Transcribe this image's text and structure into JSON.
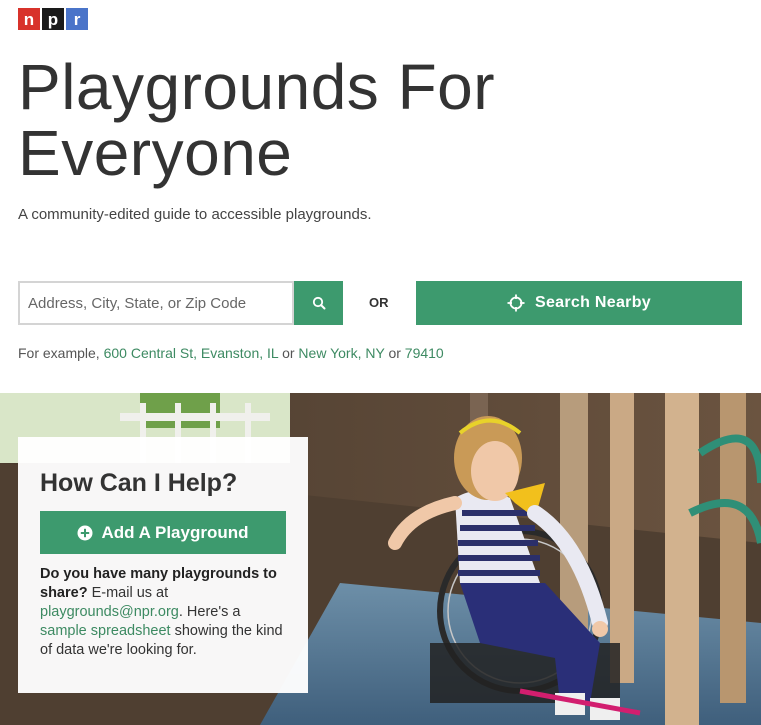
{
  "logo": {
    "letters": [
      "n",
      "p",
      "r"
    ]
  },
  "title": "Playgrounds For Everyone",
  "tagline": "A community-edited guide to accessible playgrounds.",
  "search": {
    "placeholder": "Address, City, State, or Zip Code",
    "button_icon": "search-icon",
    "or_label": "OR",
    "nearby_label": "Search Nearby",
    "nearby_icon": "crosshair-icon"
  },
  "examples": {
    "prefix": "For example,",
    "link1": "600 Central St, Evanston, IL",
    "sep1": "or",
    "link2": "New York, NY",
    "sep2": "or",
    "link3": "79410"
  },
  "help": {
    "title": "How Can I Help?",
    "add_label": "Add A Playground",
    "add_icon": "plus-circle-icon",
    "question": "Do you have many playgrounds to share?",
    "email_pre": "E-mail us at",
    "email": "playgrounds@npr.org",
    "mid": ". Here's a",
    "sheet_link": "sample spreadsheet",
    "tail": "showing the kind of data we're looking for."
  },
  "colors": {
    "accent": "#3d9a6e",
    "link": "#3d8a62",
    "npr_red": "#d8322b",
    "npr_blue": "#4a74c9"
  }
}
